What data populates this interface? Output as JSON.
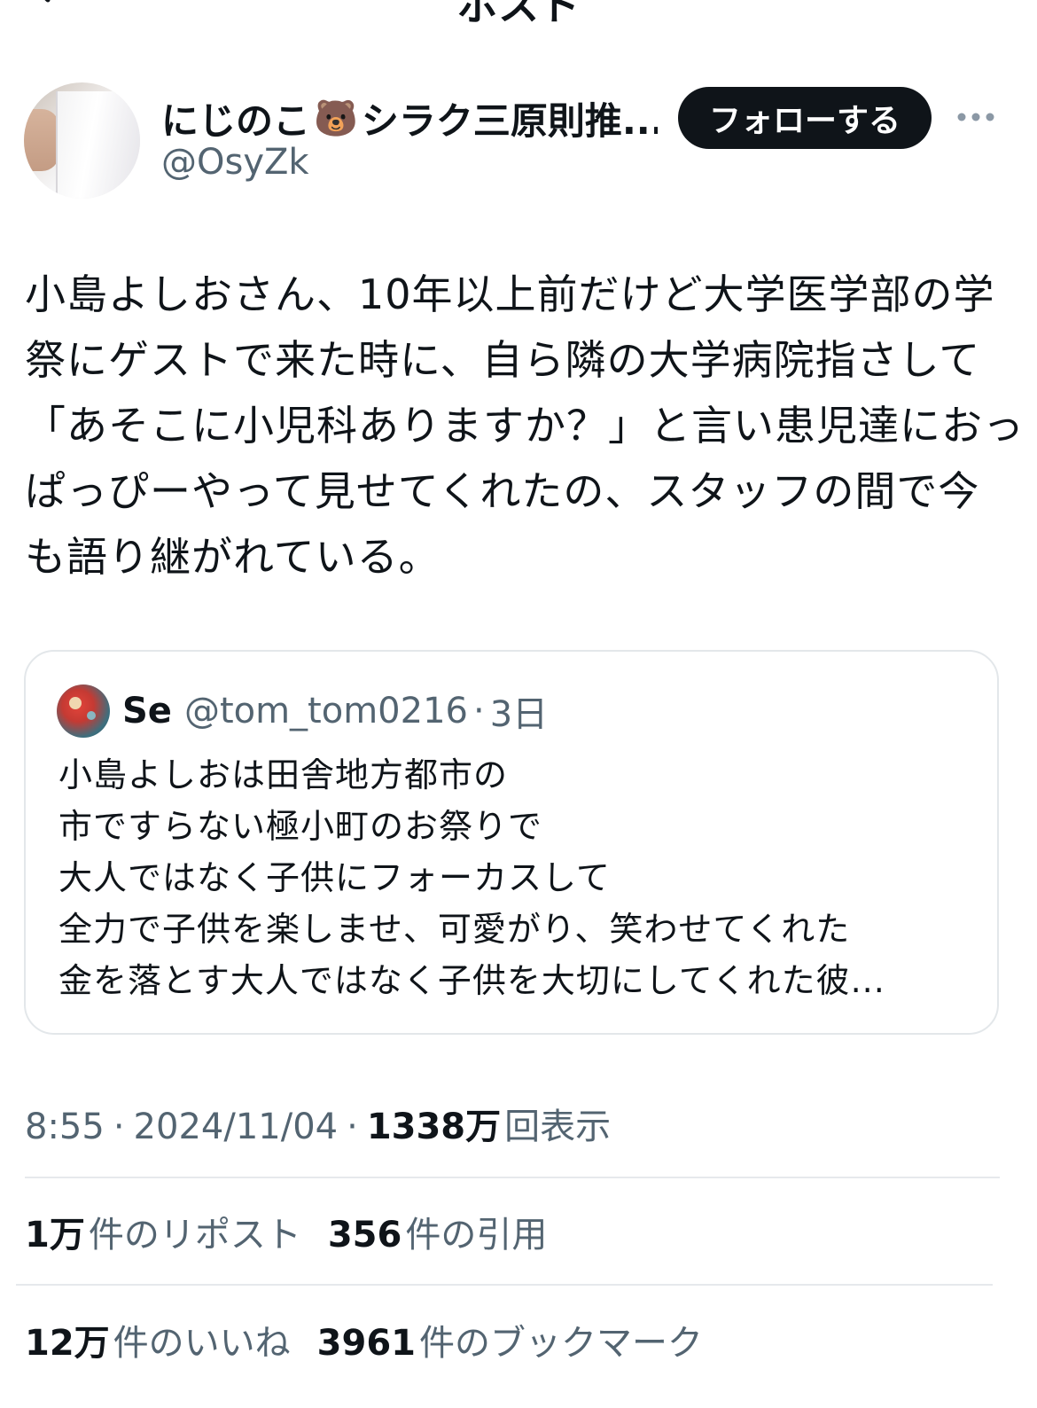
{
  "nav": {
    "title": "ポスト"
  },
  "author": {
    "name": "にじのこ",
    "emoji": "🐻",
    "name_rest": "シラク三原則推...",
    "handle": "@OsyZk"
  },
  "follow_label": "フォローする",
  "post": {
    "lines": [
      "小島よしおさん、10年以上前だけど大学医学部の学",
      "祭にゲストで来た時に、自ら隣の大学病院指さして",
      "「あそこに小児科ありますか？」と言い患児達におっ",
      "ぱっぴーやって見せてくれたの、スタッフの間で今",
      "も語り継がれている。"
    ]
  },
  "quote": {
    "name": "Se",
    "handle": "@tom_tom0216",
    "dot": "·",
    "time": "3日",
    "lines": [
      "小島よしおは田舎地方都市の",
      "市ですらない極小町のお祭りで",
      "大人ではなく子供にフォーカスして",
      "全力で子供を楽しませ、可愛がり、笑わせてくれた",
      "金を落とす大人ではなく子供を大切にしてくれた彼..."
    ]
  },
  "meta": {
    "time": "8:55",
    "sep": "·",
    "date": "2024/11/04",
    "views": "1338万",
    "views_label": "回表示"
  },
  "stats": {
    "reposts": "1万",
    "reposts_label": "件のリポスト",
    "quotes": "356",
    "quotes_label": "件の引用",
    "likes": "12万",
    "likes_label": "件のいいね",
    "bookmarks": "3961",
    "bookmarks_label": "件のブックマーク"
  }
}
